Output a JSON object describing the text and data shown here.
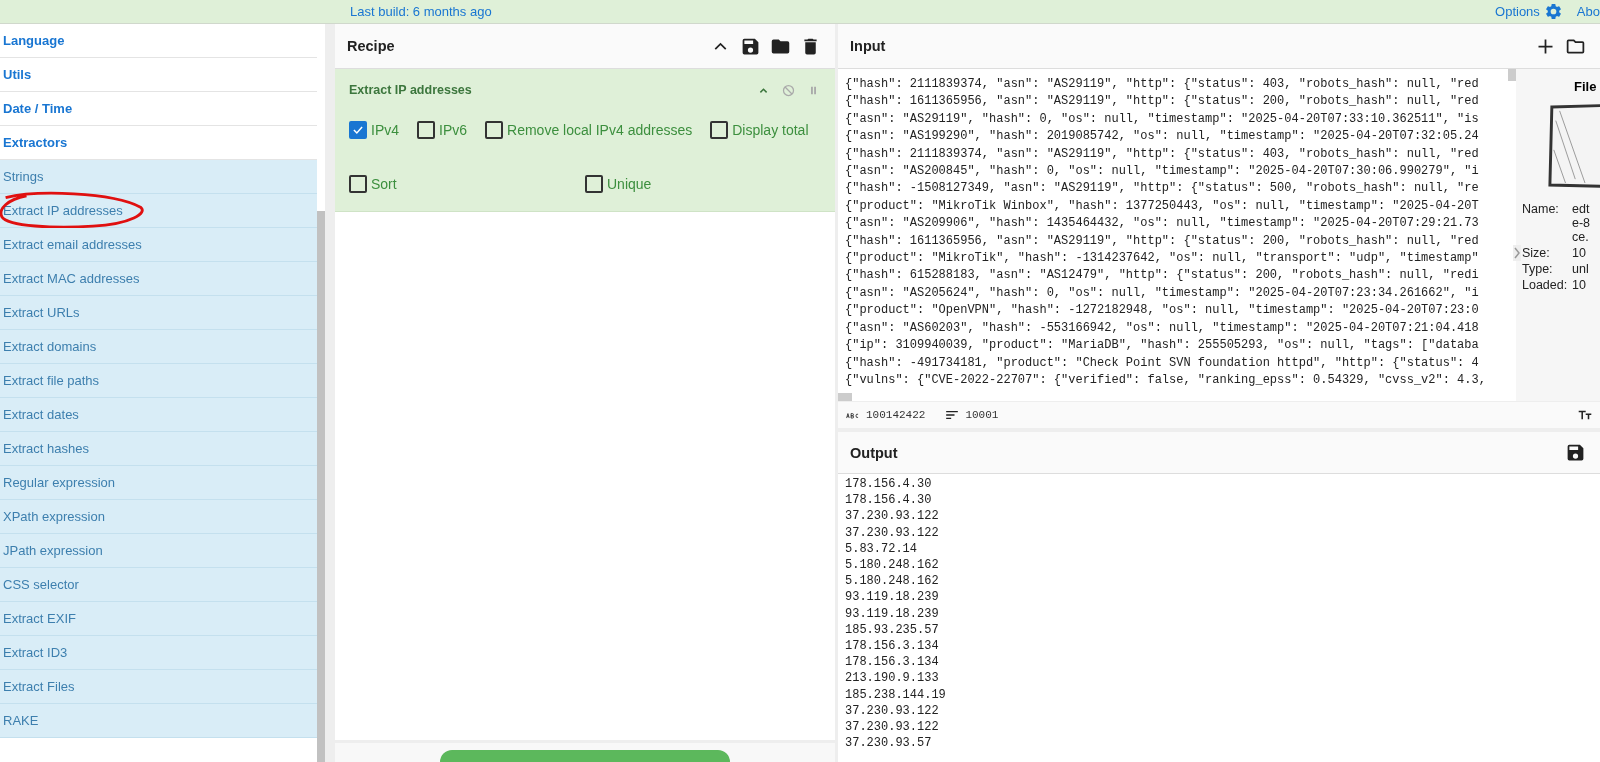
{
  "top_bar": {
    "build": "Last build: 6 months ago",
    "options": "Options",
    "about": "Abo"
  },
  "sidebar": {
    "categories": [
      {
        "label": "Language"
      },
      {
        "label": "Utils"
      },
      {
        "label": "Date / Time"
      },
      {
        "label": "Extractors"
      }
    ],
    "operations": [
      {
        "label": "Strings",
        "circled": false
      },
      {
        "label": "Extract IP addresses",
        "circled": true
      },
      {
        "label": "Extract email addresses",
        "circled": false
      },
      {
        "label": "Extract MAC addresses",
        "circled": false
      },
      {
        "label": "Extract URLs",
        "circled": false
      },
      {
        "label": "Extract domains",
        "circled": false
      },
      {
        "label": "Extract file paths",
        "circled": false
      },
      {
        "label": "Extract dates",
        "circled": false
      },
      {
        "label": "Extract hashes",
        "circled": false
      },
      {
        "label": "Regular expression",
        "circled": false
      },
      {
        "label": "XPath expression",
        "circled": false
      },
      {
        "label": "JPath expression",
        "circled": false
      },
      {
        "label": "CSS selector",
        "circled": false
      },
      {
        "label": "Extract EXIF",
        "circled": false
      },
      {
        "label": "Extract ID3",
        "circled": false
      },
      {
        "label": "Extract Files",
        "circled": false
      },
      {
        "label": "RAKE",
        "circled": false
      }
    ]
  },
  "recipe": {
    "title": "Recipe",
    "operation": {
      "name": "Extract IP addresses",
      "option_rows": [
        {
          "kind": "inline",
          "options": [
            {
              "label": "IPv4",
              "checked": true
            },
            {
              "label": "IPv6",
              "checked": false
            },
            {
              "label": "Remove local IPv4 addresses",
              "checked": false
            },
            {
              "label": "Display total",
              "checked": false
            }
          ]
        },
        {
          "kind": "split",
          "options": [
            {
              "label": "Sort",
              "checked": false
            },
            {
              "label": "Unique",
              "checked": false
            }
          ]
        }
      ]
    }
  },
  "input": {
    "title": "Input",
    "lines": [
      "{\"hash\": 2111839374, \"asn\": \"AS29119\", \"http\": {\"status\": 403, \"robots_hash\": null, \"red",
      "{\"hash\": 1611365956, \"asn\": \"AS29119\", \"http\": {\"status\": 200, \"robots_hash\": null, \"red",
      "{\"asn\": \"AS29119\", \"hash\": 0, \"os\": null, \"timestamp\": \"2025-04-20T07:33:10.362511\", \"is",
      "{\"asn\": \"AS199290\", \"hash\": 2019085742, \"os\": null, \"timestamp\": \"2025-04-20T07:32:05.24",
      "{\"hash\": 2111839374, \"asn\": \"AS29119\", \"http\": {\"status\": 403, \"robots_hash\": null, \"red",
      "{\"asn\": \"AS200845\", \"hash\": 0, \"os\": null, \"timestamp\": \"2025-04-20T07:30:06.990279\", \"i",
      "{\"hash\": -1508127349, \"asn\": \"AS29119\", \"http\": {\"status\": 500, \"robots_hash\": null, \"re",
      "{\"product\": \"MikroTik Winbox\", \"hash\": 1377250443, \"os\": null, \"timestamp\": \"2025-04-20T",
      "{\"asn\": \"AS209906\", \"hash\": 1435464432, \"os\": null, \"timestamp\": \"2025-04-20T07:29:21.73",
      "{\"hash\": 1611365956, \"asn\": \"AS29119\", \"http\": {\"status\": 200, \"robots_hash\": null, \"red",
      "{\"product\": \"MikroTik\", \"hash\": -1314237642, \"os\": null, \"transport\": \"udp\", \"timestamp\"",
      "{\"hash\": 615288183, \"asn\": \"AS12479\", \"http\": {\"status\": 200, \"robots_hash\": null, \"redi",
      "{\"asn\": \"AS205624\", \"hash\": 0, \"os\": null, \"timestamp\": \"2025-04-20T07:23:34.261662\", \"i",
      "{\"product\": \"OpenVPN\", \"hash\": -1272182948, \"os\": null, \"timestamp\": \"2025-04-20T07:23:0",
      "{\"asn\": \"AS60203\", \"hash\": -553166942, \"os\": null, \"timestamp\": \"2025-04-20T07:21:04.418",
      "{\"ip\": 3109940039, \"product\": \"MariaDB\", \"hash\": 255505293, \"os\": null, \"tags\": [\"databa",
      "{\"hash\": -491734181, \"product\": \"Check Point SVN foundation httpd\", \"http\": {\"status\": 4",
      "{\"vulns\": {\"CVE-2022-22707\": {\"verified\": false, \"ranking_epss\": 0.54329, \"cvss_v2\": 4.3,"
    ],
    "file": {
      "title": "File",
      "details": [
        {
          "label": "Name:",
          "value_lines": [
            "edt",
            "e-8",
            "ce."
          ]
        },
        {
          "label": "Size:",
          "value_lines": [
            "10"
          ]
        },
        {
          "label": "Type:",
          "value_lines": [
            "unl"
          ]
        },
        {
          "label": "Loaded:",
          "value_lines": [
            "10"
          ]
        }
      ]
    },
    "status": {
      "length": "100142422",
      "lines": "10001"
    }
  },
  "output": {
    "title": "Output",
    "lines": [
      "178.156.4.30",
      "178.156.4.30",
      "37.230.93.122",
      "37.230.93.122",
      "5.83.72.14",
      "5.180.248.162",
      "5.180.248.162",
      "93.119.18.239",
      "93.119.18.239",
      "185.93.235.57",
      "178.156.3.134",
      "178.156.3.134",
      "213.190.9.133",
      "185.238.144.19",
      "37.230.93.122",
      "37.230.93.122",
      "37.230.93.57"
    ]
  }
}
